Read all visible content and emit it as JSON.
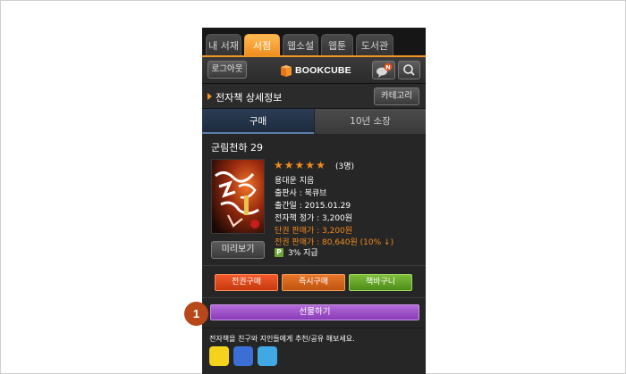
{
  "tabs": [
    {
      "label": "내 서재",
      "active": false
    },
    {
      "label": "서점",
      "active": true
    },
    {
      "label": "웹소설",
      "active": false
    },
    {
      "label": "웹툰",
      "active": false
    },
    {
      "label": "도서관",
      "active": false
    }
  ],
  "header": {
    "logout_label": "로그아웃",
    "logo_text": "BOOKCUBE",
    "notify_badge": "N"
  },
  "section": {
    "title": "전자책 상세정보",
    "category_label": "카테고리"
  },
  "subtabs": {
    "buy": "구매",
    "own": "10년 소장"
  },
  "book": {
    "title": "군림천하 29",
    "rating_count": "(3명)",
    "author": "용대운 지음",
    "publisher": "출판사 : 북큐브",
    "published": "출간일 : 2015.01.29",
    "ebook_price": "전자책 정가 : 3,200원",
    "single_price": "단권 판매가 : 3,200원",
    "all_price": "전권 판매가 : 80,640원 (10% ↓)",
    "point_badge": "P",
    "point_text": "3% 지급",
    "preview_label": "미리보기",
    "rating": 5,
    "rating_max": 5
  },
  "actions": {
    "buy_all": "전권구매",
    "buy_now": "즉시구매",
    "cart": "책바구니",
    "gift": "선물하기"
  },
  "share": {
    "text": "전자책을 친구와 지인들에게 추천/공유 해보세요."
  },
  "callout": {
    "number": "1"
  },
  "colors": {
    "accent": "#f29522",
    "gift": "#9a4cc8",
    "buy_all": "#e04a1a",
    "buy_now": "#d8661e",
    "cart": "#6aa82e",
    "callout": "#b8471a"
  }
}
